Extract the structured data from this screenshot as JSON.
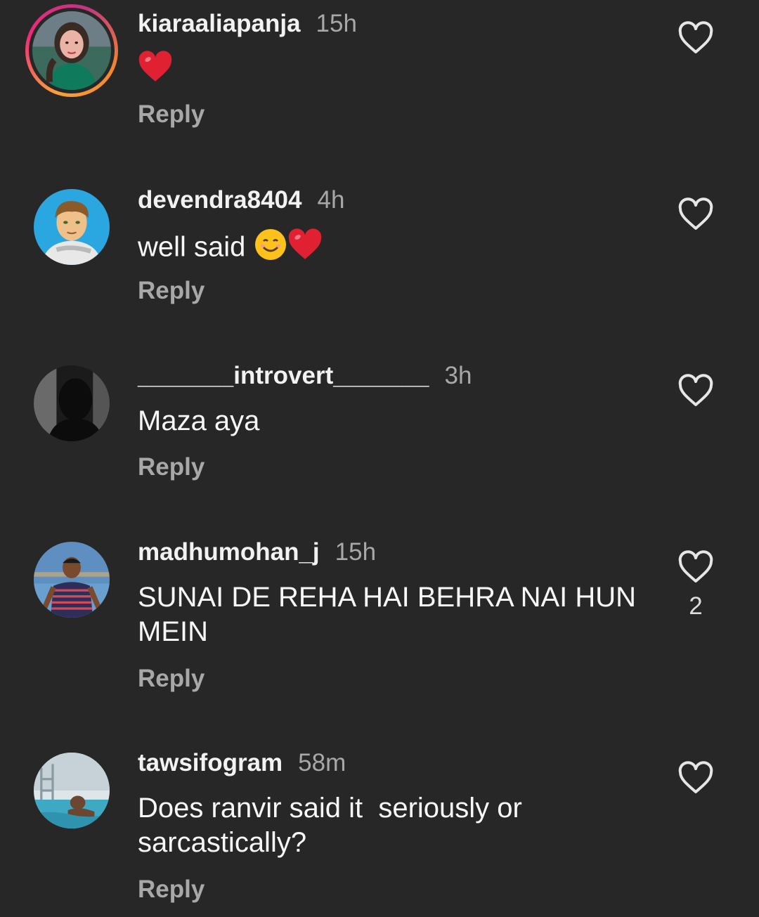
{
  "comments": [
    {
      "username": "kiaraaliapanja",
      "time": "15h",
      "text": "",
      "emoji": "heart",
      "reply": "Reply"
    },
    {
      "username": "devendra8404",
      "time": "4h",
      "text": "well said",
      "emoji": "smile-heart",
      "reply": "Reply"
    },
    {
      "username": "_______introvert_______",
      "time": "3h",
      "text": "Maza aya",
      "reply": "Reply"
    },
    {
      "username": "madhumohan_j",
      "time": "15h",
      "text": "SUNAI DE REHA HAI BEHRA NAI HUN MEIN",
      "reply": "Reply",
      "likes": "2"
    },
    {
      "username": "tawsifogram",
      "time": "58m",
      "text": "Does ranvir said it  seriously or sarcastically?",
      "reply": "Reply"
    }
  ],
  "icons": {
    "like": "heart-outline-icon",
    "emoji_heart": "red-heart-emoji",
    "emoji_smile": "smiling-face-emoji"
  },
  "colors": {
    "background": "#272727",
    "muted": "#a8a8a8",
    "heart_red": "#e02131",
    "story_ring": "#ee2a7b"
  }
}
